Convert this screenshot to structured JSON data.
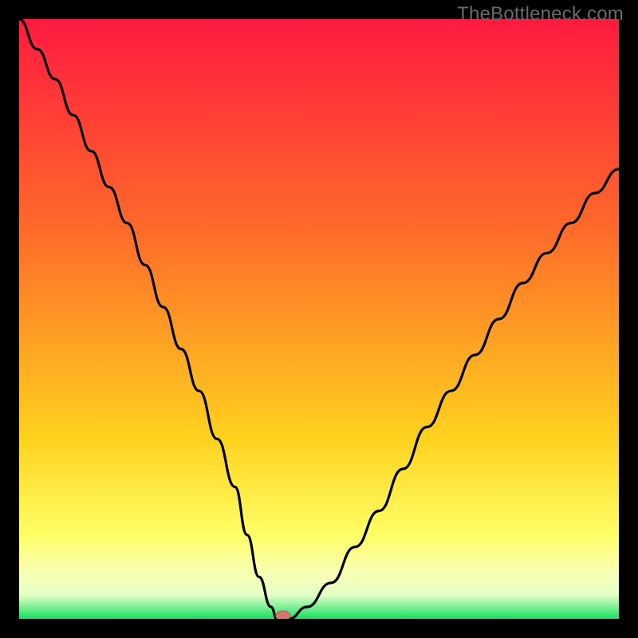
{
  "watermark": "TheBottleneck.com",
  "colors": {
    "bg": "#000000",
    "grad_top": "#ff1a40",
    "grad_mid1": "#ff6a2a",
    "grad_mid2": "#ffd21e",
    "grad_band1": "#ffff66",
    "grad_band2": "#f9ffb0",
    "grad_band3": "#e4ffc8",
    "grad_bottom": "#18e060",
    "curve": "#000000",
    "marker_fill": "#d4776e",
    "marker_stroke": "#b9564e"
  },
  "chart_data": {
    "type": "line",
    "title": "",
    "xlabel": "",
    "ylabel": "",
    "xlim": [
      0,
      100
    ],
    "ylim": [
      0,
      100
    ],
    "grid": false,
    "legend": null,
    "series": [
      {
        "name": "bottleneck-curve",
        "x": [
          0,
          3,
          6,
          9,
          12,
          15,
          18,
          21,
          24,
          27,
          30,
          33,
          36,
          38,
          40,
          42,
          43,
          45,
          48,
          52,
          56,
          60,
          64,
          68,
          72,
          76,
          80,
          84,
          88,
          92,
          96,
          100
        ],
        "y": [
          100,
          95,
          90,
          84,
          78,
          72,
          66,
          59,
          52,
          45,
          38,
          30,
          22,
          14,
          7,
          2,
          0,
          0,
          2,
          6,
          12,
          18,
          25,
          32,
          38,
          44,
          50,
          56,
          61,
          66,
          71,
          75
        ]
      }
    ],
    "marker": {
      "x": 44,
      "y": 0
    }
  }
}
